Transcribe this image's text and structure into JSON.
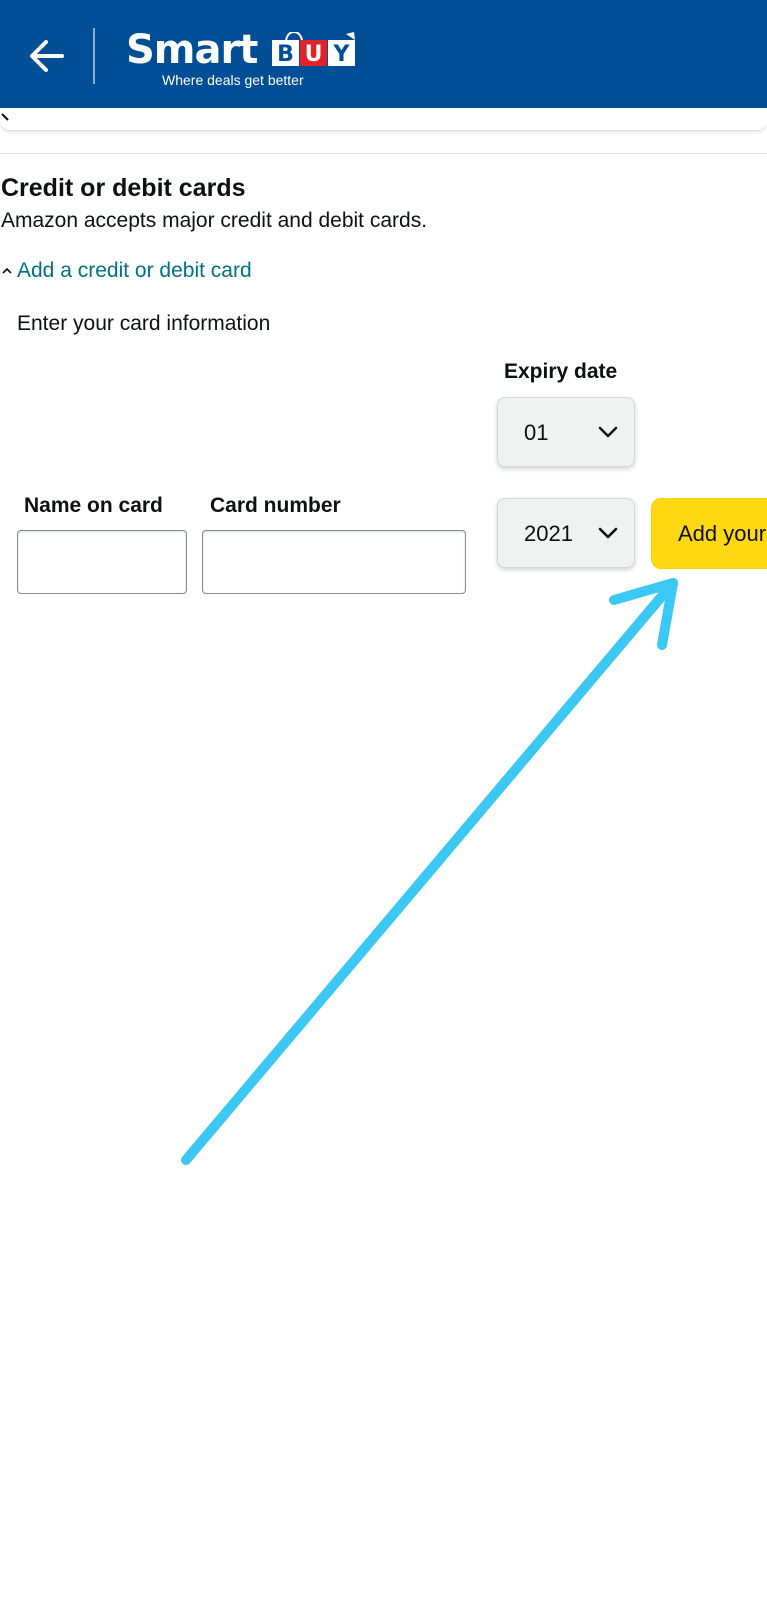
{
  "header": {
    "logo_text": "Smart",
    "logo_buy_letters": [
      "B",
      "U",
      "Y"
    ],
    "tagline": "Where deals get better",
    "back_icon": "arrow-left-icon"
  },
  "section": {
    "title": "Credit or debit cards",
    "subtitle": "Amazon accepts major credit and debit cards.",
    "add_link": "Add a credit or debit card",
    "add_link_icon": "caret-up-icon"
  },
  "form": {
    "instruction": "Enter your card information",
    "name_label": "Name on card",
    "name_value": "",
    "number_label": "Card number",
    "number_value": "",
    "expiry_label": "Expiry date",
    "expiry_month": "01",
    "expiry_year": "2021",
    "submit_label": "Add your card"
  },
  "colors": {
    "header_bg": "#004e96",
    "link": "#007185",
    "button": "#ffd814",
    "annotation": "#3bc8f5",
    "logo_buy_red": "#e32227"
  }
}
